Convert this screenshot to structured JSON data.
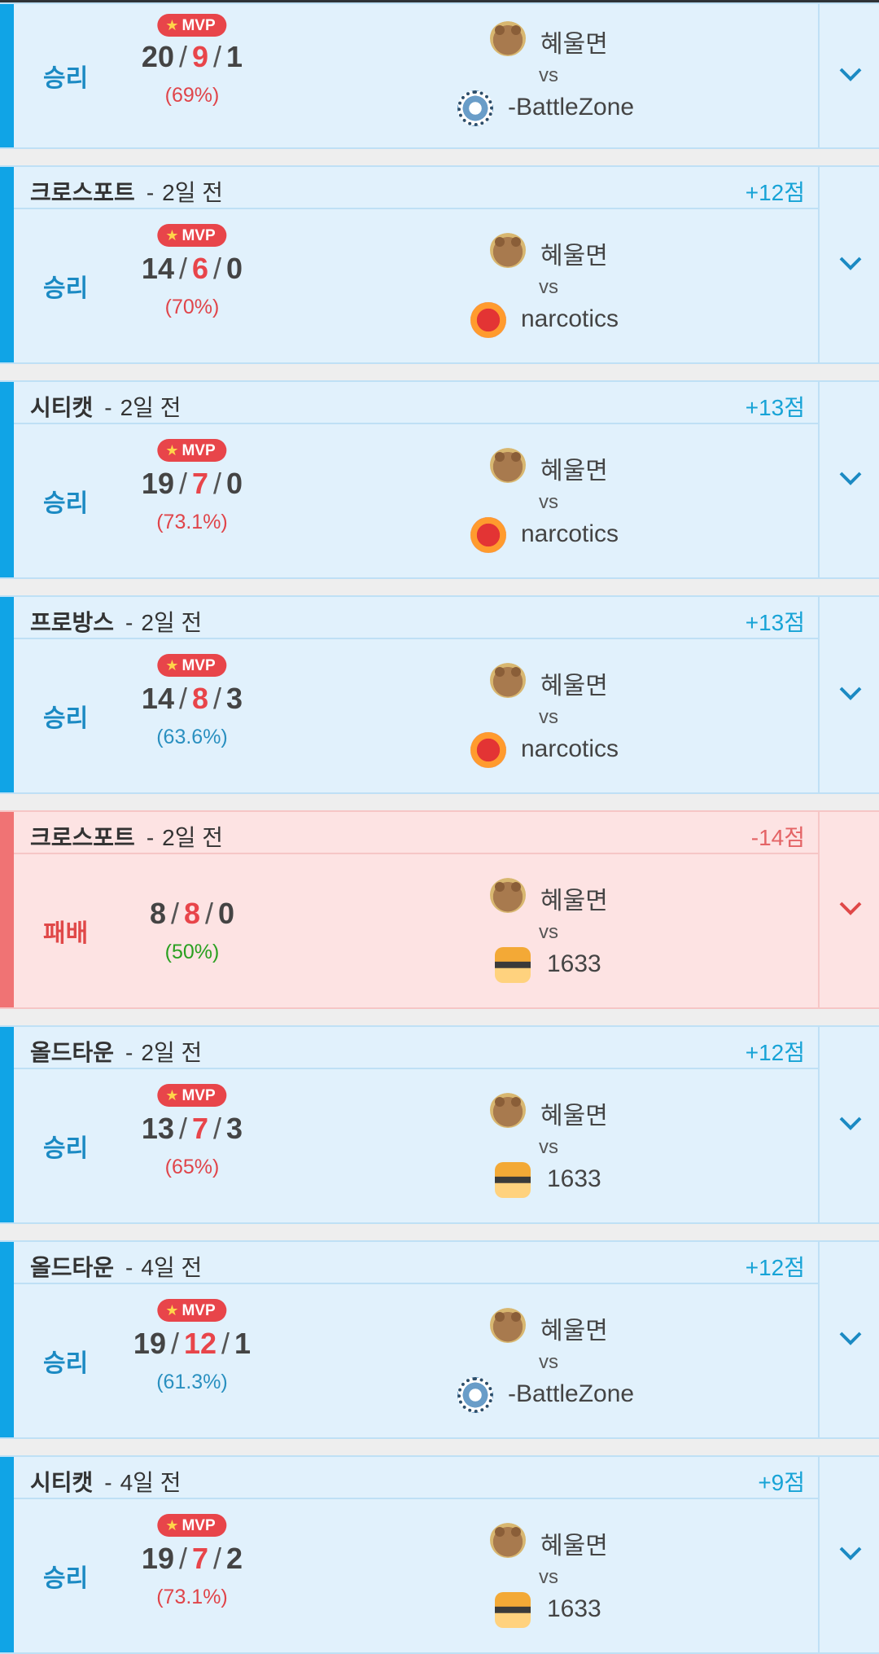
{
  "colors": {
    "win": "#1b8ac3",
    "lose": "#e04848",
    "accent": "#10a4e6",
    "mvp": "#e8454a"
  },
  "icons": {
    "expand": "chevron-down-icon",
    "mvp": "star-icon"
  },
  "matches": [
    {
      "result": "승리",
      "mvp": "MVP",
      "kills": "20",
      "deaths": "9",
      "assists": "1",
      "pct": "(69%)",
      "player": "혜울면",
      "vs": "vs",
      "opponent": "-BattleZone"
    },
    {
      "mode": "크로스포트",
      "sep": "-",
      "ago": "2일 전",
      "points": "+12점",
      "result": "승리",
      "mvp": "MVP",
      "kills": "14",
      "deaths": "6",
      "assists": "0",
      "pct": "(70%)",
      "player": "혜울면",
      "vs": "vs",
      "opponent": "narcotics"
    },
    {
      "mode": "시티캣",
      "sep": "-",
      "ago": "2일 전",
      "points": "+13점",
      "result": "승리",
      "mvp": "MVP",
      "kills": "19",
      "deaths": "7",
      "assists": "0",
      "pct": "(73.1%)",
      "player": "혜울면",
      "vs": "vs",
      "opponent": "narcotics"
    },
    {
      "mode": "프로방스",
      "sep": "-",
      "ago": "2일 전",
      "points": "+13점",
      "result": "승리",
      "mvp": "MVP",
      "kills": "14",
      "deaths": "8",
      "assists": "3",
      "pct": "(63.6%)",
      "player": "혜울면",
      "vs": "vs",
      "opponent": "narcotics"
    },
    {
      "mode": "크로스포트",
      "sep": "-",
      "ago": "2일 전",
      "points": "-14점",
      "result": "패배",
      "kills": "8",
      "deaths": "8",
      "assists": "0",
      "pct": "(50%)",
      "player": "혜울면",
      "vs": "vs",
      "opponent": "1633"
    },
    {
      "mode": "올드타운",
      "sep": "-",
      "ago": "2일 전",
      "points": "+12점",
      "result": "승리",
      "mvp": "MVP",
      "kills": "13",
      "deaths": "7",
      "assists": "3",
      "pct": "(65%)",
      "player": "혜울면",
      "vs": "vs",
      "opponent": "1633"
    },
    {
      "mode": "올드타운",
      "sep": "-",
      "ago": "4일 전",
      "points": "+12점",
      "result": "승리",
      "mvp": "MVP",
      "kills": "19",
      "deaths": "12",
      "assists": "1",
      "pct": "(61.3%)",
      "player": "혜울면",
      "vs": "vs",
      "opponent": "-BattleZone"
    },
    {
      "mode": "시티캣",
      "sep": "-",
      "ago": "4일 전",
      "points": "+9점",
      "result": "승리",
      "mvp": "MVP",
      "kills": "19",
      "deaths": "7",
      "assists": "2",
      "pct": "(73.1%)",
      "player": "혜울면",
      "vs": "vs",
      "opponent": "1633"
    }
  ]
}
